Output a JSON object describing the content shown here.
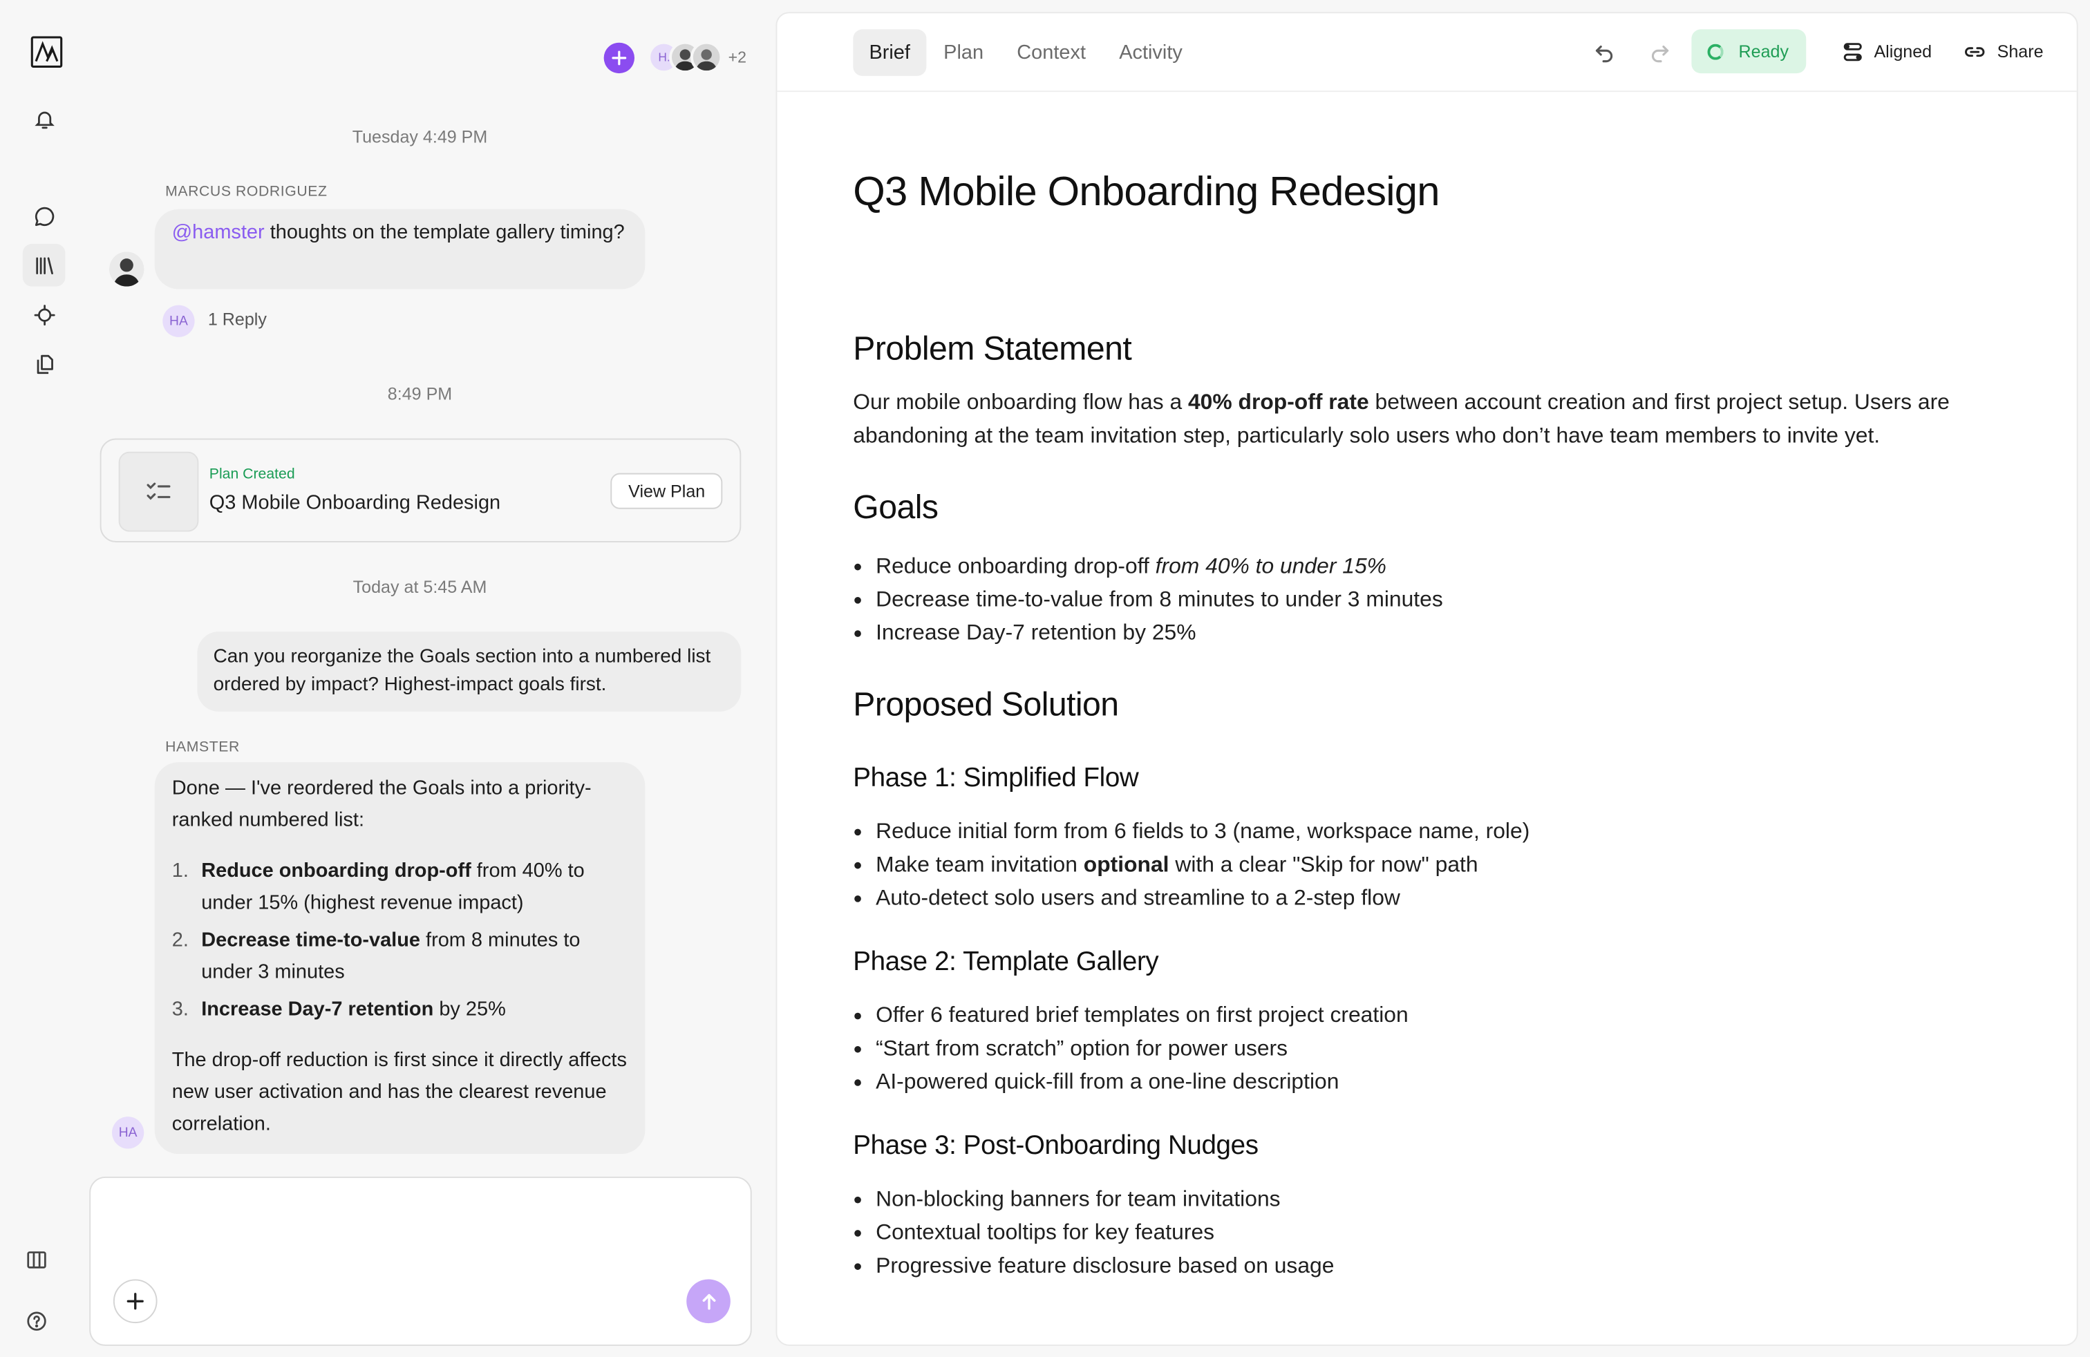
{
  "presence": {
    "initials": "H.",
    "more_count": "+2"
  },
  "chat": {
    "timestamp_1": "Tuesday 4:49 PM",
    "msg1": {
      "sender": "MARCUS RODRIGUEZ",
      "mention": "@hamster",
      "text": " thoughts on the template gallery timing?",
      "reply_avatar": "HA",
      "reply_count": "1 Reply"
    },
    "timestamp_2": "8:49 PM",
    "plan_card": {
      "label": "Plan Created",
      "title": "Q3 Mobile Onboarding Redesign",
      "button": "View Plan"
    },
    "timestamp_3": "Today at 5:45 AM",
    "user_msg": "Can you reorganize the Goals section into a numbered list ordered by impact? Highest-impact goals first.",
    "ai_msg": {
      "sender": "HAMSTER",
      "avatar": "HA",
      "intro": "Done — I've reordered the Goals into a priority-ranked numbered list:",
      "items": [
        {
          "num": "1.",
          "bold": "Reduce onboarding drop-off",
          "rest": " from 40% to under 15% (highest revenue impact)"
        },
        {
          "num": "2.",
          "bold": "Decrease time-to-value",
          "rest": " from 8 minutes to under 3 minutes"
        },
        {
          "num": "3.",
          "bold": "Increase Day-7 retention",
          "rest": " by 25%"
        }
      ],
      "outro": "The drop-off reduction is first since it directly affects new user activation and has the clearest revenue correlation."
    },
    "composer_placeholder": ""
  },
  "doc": {
    "tabs": [
      "Brief",
      "Plan",
      "Context",
      "Activity"
    ],
    "status": "Ready",
    "aligned_label": "Aligned",
    "share_label": "Share",
    "title": "Q3 Mobile Onboarding Redesign",
    "problem": {
      "heading": "Problem Statement",
      "text_1": "Our mobile onboarding flow has a ",
      "bold": "40% drop-off rate",
      "text_2": " between account creation and first project setup. Users are abandoning at the team invitation step, particularly solo users who don’t have team members to invite yet."
    },
    "goals": {
      "heading": "Goals",
      "item1_text": "Reduce onboarding drop-off ",
      "item1_italic": "from 40% to under 15%",
      "item2": "Decrease time-to-value from 8 minutes to under 3 minutes",
      "item3": "Increase Day-7 retention by 25%"
    },
    "solution": {
      "heading": "Proposed Solution",
      "phase1": {
        "heading": "Phase 1: Simplified Flow",
        "item1": "Reduce initial form from 6 fields to 3 (name, workspace name, role)",
        "item2_a": "Make team invitation ",
        "item2_bold": "optional",
        "item2_b": " with a clear \"Skip for now\" path",
        "item3": "Auto-detect solo users and streamline to a 2-step flow"
      },
      "phase2": {
        "heading": "Phase 2: Template Gallery",
        "items": [
          "Offer 6 featured brief templates on first project creation",
          "“Start from scratch” option for power users",
          "AI-powered quick-fill from a one-line description"
        ]
      },
      "phase3": {
        "heading": "Phase 3: Post-Onboarding Nudges",
        "items": [
          "Non-blocking banners for team invitations",
          "Contextual tooltips for key features",
          "Progressive feature disclosure based on usage"
        ]
      }
    }
  },
  "colors": {
    "accent_purple": "#8b4cf0",
    "ready_green": "#1f9d55",
    "ready_bg": "#dcf5e5"
  }
}
